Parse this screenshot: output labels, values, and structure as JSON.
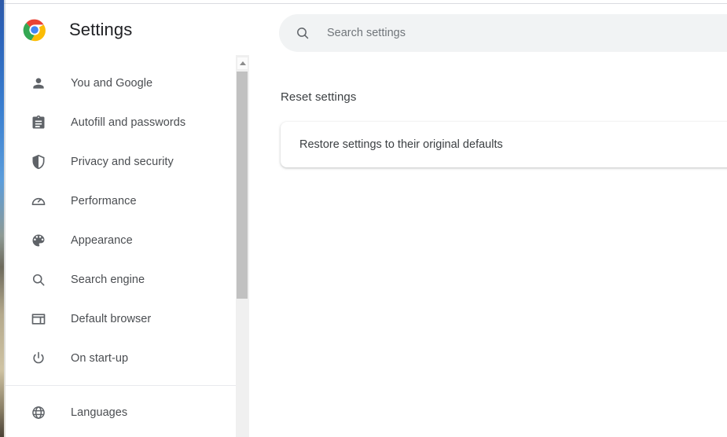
{
  "window": {
    "background_color": "#ffffff",
    "hairline_color": "#dadce0"
  },
  "sidebar": {
    "brand": {
      "logo_icon": "chrome-logo-icon",
      "title": "Settings"
    },
    "items": [
      {
        "label": "You and Google",
        "icon": "person-icon"
      },
      {
        "label": "Autofill and passwords",
        "icon": "clipboard-icon"
      },
      {
        "label": "Privacy and security",
        "icon": "shield-icon"
      },
      {
        "label": "Performance",
        "icon": "speedometer-icon"
      },
      {
        "label": "Appearance",
        "icon": "palette-icon"
      },
      {
        "label": "Search engine",
        "icon": "magnifier-icon"
      },
      {
        "label": "Default browser",
        "icon": "browser-window-icon"
      },
      {
        "label": "On start-up",
        "icon": "power-icon"
      }
    ],
    "items_after_divider": [
      {
        "label": "Languages",
        "icon": "globe-icon"
      }
    ],
    "scrollbar": {
      "up_arrow_icon": "chevron-up-icon",
      "thumb_color": "#c1c1c1",
      "track_color": "#f0f0f0"
    }
  },
  "search": {
    "icon": "search-icon",
    "placeholder": "Search settings",
    "value": ""
  },
  "main": {
    "section_title": "Reset settings",
    "cards": [
      {
        "label": "Restore settings to their original defaults"
      }
    ]
  },
  "colors": {
    "text_primary": "#202124",
    "text_secondary": "#5f6368",
    "search_bg": "#f1f3f4",
    "divider": "#e8eaed",
    "chrome_red": "#ea4335",
    "chrome_yellow": "#fbbc05",
    "chrome_green": "#34a853",
    "chrome_blue": "#4285f4"
  }
}
